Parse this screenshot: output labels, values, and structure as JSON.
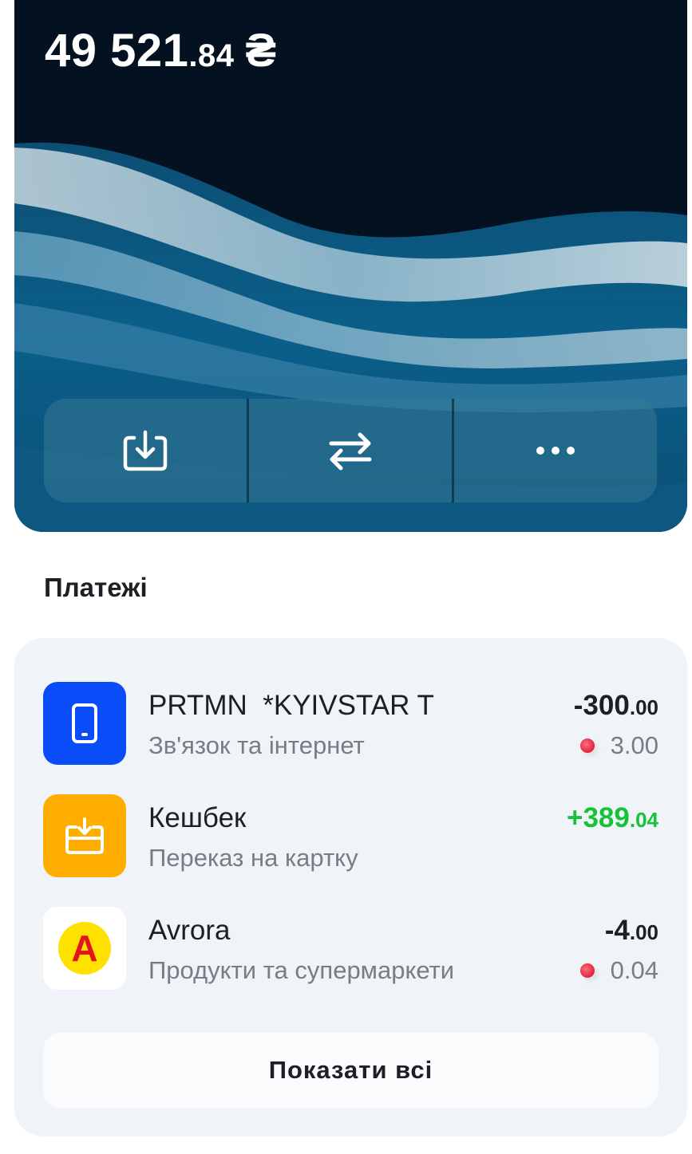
{
  "balance": {
    "whole": "49 521",
    "cents": ".84",
    "currency": "₴"
  },
  "actions": [
    {
      "icon": "top-up-icon"
    },
    {
      "icon": "transfer-icon"
    },
    {
      "icon": "more-icon"
    }
  ],
  "payments": {
    "title": "Платежі",
    "items": [
      {
        "title": "PRTMN  *KYIVSTAR T",
        "category": "Зв'язок та інтернет",
        "amount_main": "-300",
        "amount_cents": ".00",
        "cashback": "3.00",
        "icon": "phone-icon",
        "color": "#0a4cf7",
        "positive": false
      },
      {
        "title": "Кешбек",
        "category": "Переказ на картку",
        "amount_main": "+389",
        "amount_cents": ".04",
        "cashback": "",
        "icon": "cashback-icon",
        "color": "#ffae00",
        "positive": true
      },
      {
        "title": "Avrora",
        "category": "Продукти та супермаркети",
        "amount_main": "-4",
        "amount_cents": ".00",
        "cashback": "0.04",
        "icon": "avrora-logo",
        "logo_letter": "A",
        "color": "#ffffff",
        "positive": false
      }
    ],
    "show_all_label": "Показати всі"
  },
  "colors": {
    "amount_positive": "#17c23b",
    "cashback_dot": "#e0243c",
    "card_background": "#031120",
    "panel_background": "#f0f3f8"
  }
}
